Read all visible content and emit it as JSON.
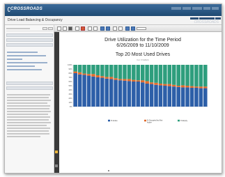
{
  "app": {
    "logo_text": "CROSSROADS",
    "top_links": [
      "",
      "",
      "",
      "",
      ""
    ],
    "page_title": "Drive Load Balancing & Occupancy",
    "sub_tabs": [
      "",
      "",
      ""
    ],
    "watermark": "CROSSROADS"
  },
  "report": {
    "title_line1": "Drive Utilization for the Time Period",
    "title_line2": "6/26/2009 to 11/10/2009",
    "chart_title": "Top 20 Most Used Drives",
    "chart_subtitle": "For 7/1/2024"
  },
  "colors": {
    "header": "#1f4a72",
    "series_active": "#2d5fa8",
    "series_occupied": "#e26b2c",
    "series_empty": "#2e9e7d"
  },
  "chart_data": {
    "type": "bar",
    "stacked": true,
    "title": "Top 20 Most Used Drives",
    "subtitle": "For 7/1/2024",
    "ylim": [
      0,
      100
    ],
    "yticks": [
      "0%",
      "10%",
      "20%",
      "30%",
      "40%",
      "50%",
      "60%",
      "70%",
      "80%",
      "90%",
      "100%"
    ],
    "categories": [
      "",
      "",
      "",
      "",
      "",
      "",
      "",
      "",
      "",
      "",
      "",
      "",
      "",
      "",
      "",
      "",
      "",
      "",
      "",
      "",
      "",
      "",
      "",
      "",
      "",
      "",
      "",
      "",
      "",
      ""
    ],
    "series": [
      {
        "name": "% Active",
        "color": "#2d5fa8",
        "values": [
          80,
          77,
          76,
          74,
          72,
          70,
          69,
          67,
          66,
          64,
          63,
          62,
          61,
          60,
          60,
          58,
          55,
          54,
          52,
          51,
          50,
          49,
          48,
          47,
          46,
          46,
          45,
          45,
          44,
          44
        ]
      },
      {
        "name": "% Occupied but Not Active",
        "color": "#e26b2c",
        "values": [
          4,
          5,
          3,
          4,
          6,
          5,
          4,
          4,
          5,
          4,
          3,
          4,
          5,
          4,
          3,
          5,
          6,
          4,
          5,
          4,
          4,
          5,
          4,
          3,
          5,
          4,
          4,
          3,
          4,
          4
        ]
      },
      {
        "name": "% Empty",
        "color": "#2e9e7d",
        "values": [
          16,
          18,
          21,
          22,
          22,
          25,
          27,
          29,
          29,
          32,
          34,
          34,
          34,
          36,
          37,
          37,
          39,
          42,
          43,
          45,
          46,
          46,
          48,
          50,
          49,
          50,
          51,
          52,
          52,
          52
        ]
      }
    ],
    "legend_position": "bottom",
    "grid": false
  }
}
